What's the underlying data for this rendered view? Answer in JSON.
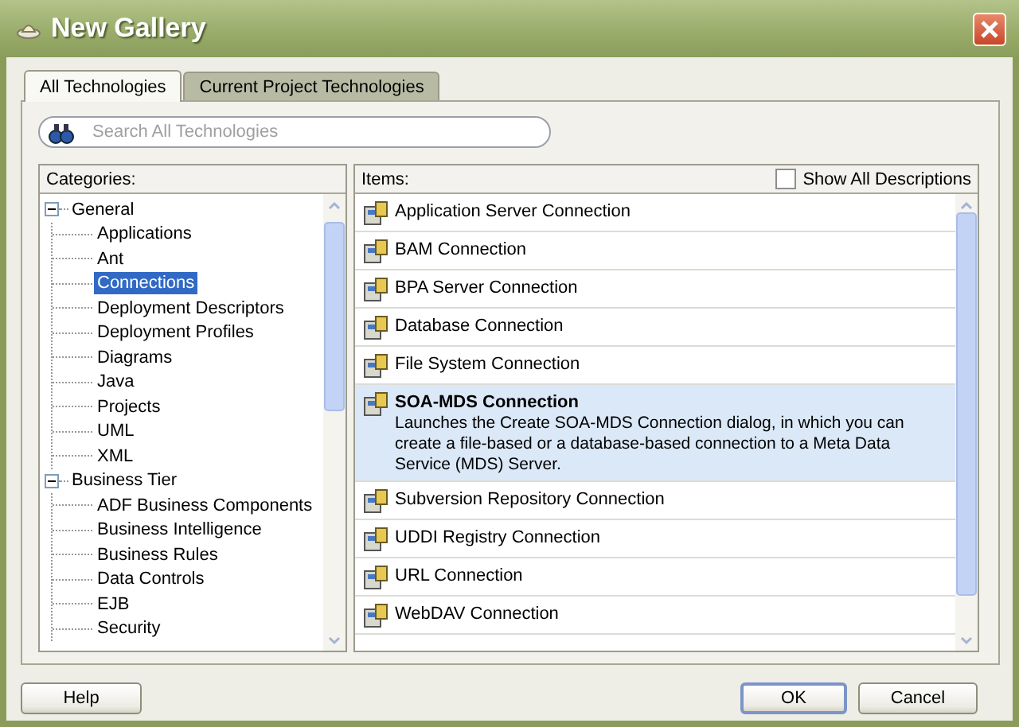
{
  "window": {
    "title": "New Gallery"
  },
  "tabs": [
    {
      "label": "All Technologies",
      "selected": true
    },
    {
      "label": "Current Project Technologies",
      "selected": false
    }
  ],
  "search": {
    "placeholder": "Search All Technologies"
  },
  "categories": {
    "label": "Categories:",
    "tree": [
      {
        "label": "General",
        "expanded": true,
        "selected": false,
        "children": [
          {
            "label": "Applications",
            "selected": false
          },
          {
            "label": "Ant",
            "selected": false
          },
          {
            "label": "Connections",
            "selected": true
          },
          {
            "label": "Deployment Descriptors",
            "selected": false
          },
          {
            "label": "Deployment Profiles",
            "selected": false
          },
          {
            "label": "Diagrams",
            "selected": false
          },
          {
            "label": "Java",
            "selected": false
          },
          {
            "label": "Projects",
            "selected": false
          },
          {
            "label": "UML",
            "selected": false
          },
          {
            "label": "XML",
            "selected": false
          }
        ]
      },
      {
        "label": "Business Tier",
        "expanded": true,
        "selected": false,
        "children": [
          {
            "label": "ADF Business Components",
            "selected": false
          },
          {
            "label": "Business Intelligence",
            "selected": false
          },
          {
            "label": "Business Rules",
            "selected": false
          },
          {
            "label": "Data Controls",
            "selected": false
          },
          {
            "label": "EJB",
            "selected": false
          },
          {
            "label": "Security",
            "selected": false
          }
        ]
      }
    ]
  },
  "items": {
    "label": "Items:",
    "show_all": {
      "label": "Show All Descriptions",
      "checked": false
    },
    "list": [
      {
        "title": "Application Server Connection",
        "selected": false
      },
      {
        "title": "BAM Connection",
        "selected": false
      },
      {
        "title": "BPA Server Connection",
        "selected": false
      },
      {
        "title": "Database Connection",
        "selected": false
      },
      {
        "title": "File System Connection",
        "selected": false
      },
      {
        "title": "SOA-MDS Connection",
        "selected": true,
        "description": "Launches the Create SOA-MDS Connection dialog, in which you can create a file-based or a database-based connection to a Meta Data Service (MDS) Server."
      },
      {
        "title": "Subversion Repository Connection",
        "selected": false
      },
      {
        "title": "UDDI Registry Connection",
        "selected": false
      },
      {
        "title": "URL Connection",
        "selected": false
      },
      {
        "title": "WebDAV Connection",
        "selected": false
      }
    ]
  },
  "buttons": [
    {
      "label": "Help",
      "default": false
    },
    {
      "label": "OK",
      "default": true
    },
    {
      "label": "Cancel",
      "default": false
    }
  ]
}
